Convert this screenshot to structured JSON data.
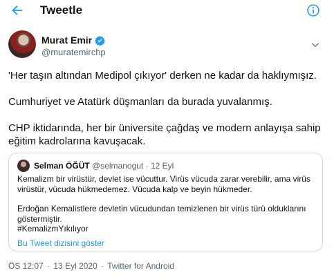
{
  "header": {
    "title": "Tweetle",
    "back_icon": "back-arrow-icon",
    "info_icon": "info-icon"
  },
  "author": {
    "name": "Murat Emir",
    "handle": "@muratemirchp",
    "verified": true
  },
  "tweet": {
    "paragraphs": [
      "'Her taşın altından Medipol çıkıyor' derken ne kadar da haklıymışız.",
      "Cumhuriyet ve Atatürk düşmanları da burada yuvalanmış.",
      "CHP iktidarında, her bir üniversite çağdaş ve modern anlayışa sahip eğitim kadrolarına kavuşacak."
    ]
  },
  "quote": {
    "name": "Selman ÖĞÜT",
    "handle": "@selmanogut",
    "separator": "·",
    "date": "12 Eyl",
    "paragraph1": "Kemalizm bir virüstür, devlet ise vücuttur. Virüs vücuda zarar verebilir, ama virüs virüstür, vücuda hükmedemez. Vücuda kalp ve beyin hükmeder.",
    "paragraph2": "Erdoğan Kemalistlere devletin vücudundan temizlenen bir virüs türü olduklarını göstermiştir.",
    "hashtag": "#KemalizmYıkılıyor",
    "thread_link": "Bu Tweet dizisini göster"
  },
  "footer": {
    "time": "ÖS 12:07",
    "sep": "·",
    "date": "13 Eyl 2020",
    "source": "Twitter for Android"
  },
  "colors": {
    "accent": "#1d9bf0",
    "text": "#0f1419",
    "muted": "#536471",
    "border": "#cfd9de"
  }
}
